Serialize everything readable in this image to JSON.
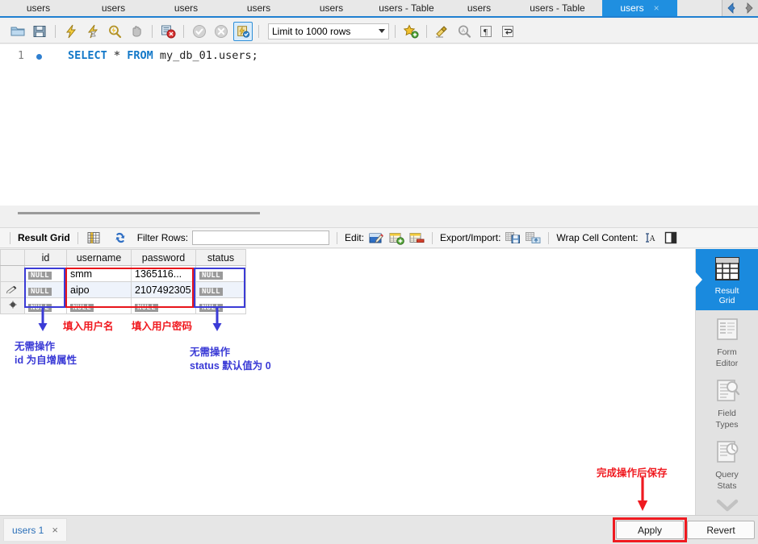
{
  "editor_tabs": [
    {
      "label": "users",
      "active": false
    },
    {
      "label": "users",
      "active": false
    },
    {
      "label": "users",
      "active": false
    },
    {
      "label": "users",
      "active": false
    },
    {
      "label": "users",
      "active": false
    },
    {
      "label": "users - Table",
      "active": false
    },
    {
      "label": "users",
      "active": false
    },
    {
      "label": "users - Table",
      "active": false
    },
    {
      "label": "users",
      "active": true,
      "close": "×"
    }
  ],
  "tab_nav": {
    "prev_icon": "arrow-left-icon",
    "next_icon": "arrow-right-icon"
  },
  "toolbar": {
    "buttons": [
      {
        "name": "open-sql-script-icon",
        "title": "Open a SQL script file"
      },
      {
        "name": "save-script-icon",
        "title": "Save script to file"
      },
      {
        "name": "execute-statement-icon",
        "title": "Execute the selected statement"
      },
      {
        "name": "execute-current-statement-icon",
        "title": "Execute current statement"
      },
      {
        "name": "explain-statement-icon",
        "title": "Explain the statement"
      },
      {
        "name": "stop-statement-icon",
        "title": "Stop the query"
      },
      {
        "name": "toggle-stop-on-error-icon",
        "title": "Toggle stop on error"
      },
      {
        "name": "commit-icon",
        "title": "Commit"
      },
      {
        "name": "rollback-icon",
        "title": "Rollback"
      },
      {
        "name": "autocommit-icon",
        "title": "Toggle auto-commit",
        "selected": true
      }
    ],
    "limit_label": "Limit to 1000 rows",
    "right_buttons": [
      {
        "name": "add-snippet-icon",
        "title": "Save current statement to snippets"
      },
      {
        "name": "beautify-sql-icon",
        "title": "Beautify/reformat the SQL script"
      },
      {
        "name": "find-icon",
        "title": "Find"
      },
      {
        "name": "invisible-chars-icon",
        "title": "Toggle invisible characters"
      },
      {
        "name": "wrap-lines-icon",
        "title": "Toggle wrapping of long lines"
      }
    ]
  },
  "sql": {
    "line_number": "1",
    "tokens": [
      {
        "t": "SELECT",
        "c": "kw"
      },
      {
        "t": " ",
        "c": "idt"
      },
      {
        "t": "*",
        "c": "op"
      },
      {
        "t": " ",
        "c": "idt"
      },
      {
        "t": "FROM",
        "c": "kw"
      },
      {
        "t": " my_db_01.users;",
        "c": "idt"
      }
    ],
    "plain": "SELECT * FROM my_db_01.users;"
  },
  "result_toolbar": {
    "title": "Result Grid",
    "grid_icon": "grid-view-icon",
    "refresh_icon": "refresh-icon",
    "filter_label": "Filter Rows:",
    "filter_value": "",
    "filter_placeholder": "",
    "edit_label": "Edit:",
    "edit_icons": [
      "edit-cell-icon",
      "insert-row-icon",
      "delete-row-icon"
    ],
    "export_label": "Export/Import:",
    "export_icons": [
      "export-recordset-icon",
      "import-recordset-icon"
    ],
    "wrap_label": "Wrap Cell Content:",
    "wrap_icons": [
      "wrap-text-icon",
      "toggle-panel-icon"
    ]
  },
  "grid": {
    "columns": [
      "id",
      "username",
      "password",
      "status"
    ],
    "null_text": "NULL",
    "rows": [
      {
        "marker": "",
        "id": "NULL",
        "username": "smm",
        "password": "1365116...",
        "status": "NULL"
      },
      {
        "marker": "pencil-icon",
        "id": "NULL",
        "username": "aipo",
        "password": "2107492305",
        "status": "NULL"
      },
      {
        "marker": "new-row-icon",
        "id": "NULL",
        "username": "NULL",
        "password": "NULL",
        "status": "NULL"
      }
    ]
  },
  "annotations": [
    {
      "name": "annotation-username",
      "text": "填入用户名",
      "color": "red"
    },
    {
      "name": "annotation-password",
      "text": "填入用户密码",
      "color": "red"
    },
    {
      "name": "annotation-id-line1",
      "text": "无需操作",
      "color": "blue"
    },
    {
      "name": "annotation-id-line2",
      "text": "id 为自增属性",
      "color": "blue"
    },
    {
      "name": "annotation-status-line1",
      "text": "无需操作",
      "color": "blue"
    },
    {
      "name": "annotation-status-line2",
      "text": "status 默认值为 0",
      "color": "blue"
    },
    {
      "name": "annotation-apply",
      "text": "完成操作后保存",
      "color": "red"
    }
  ],
  "side_panel": {
    "items": [
      {
        "label_line1": "Result",
        "label_line2": "Grid",
        "icon": "result-grid-icon",
        "active": true
      },
      {
        "label_line1": "Form",
        "label_line2": "Editor",
        "icon": "form-editor-icon",
        "active": false
      },
      {
        "label_line1": "Field",
        "label_line2": "Types",
        "icon": "field-types-icon",
        "active": false
      },
      {
        "label_line1": "Query",
        "label_line2": "Stats",
        "icon": "query-stats-icon",
        "active": false
      }
    ],
    "chevron_icon": "chevron-down-icon"
  },
  "bottom": {
    "resultset_tab": "users 1",
    "resultset_close": "×",
    "apply_label": "Apply",
    "revert_label": "Revert"
  },
  "colors": {
    "accent_blue": "#1a8ade",
    "annotation_red": "#f01a20",
    "annotation_blue": "#3b3bd6",
    "grid_alt_row": "#eef3fb",
    "null_badge": "#9a9a9a"
  }
}
